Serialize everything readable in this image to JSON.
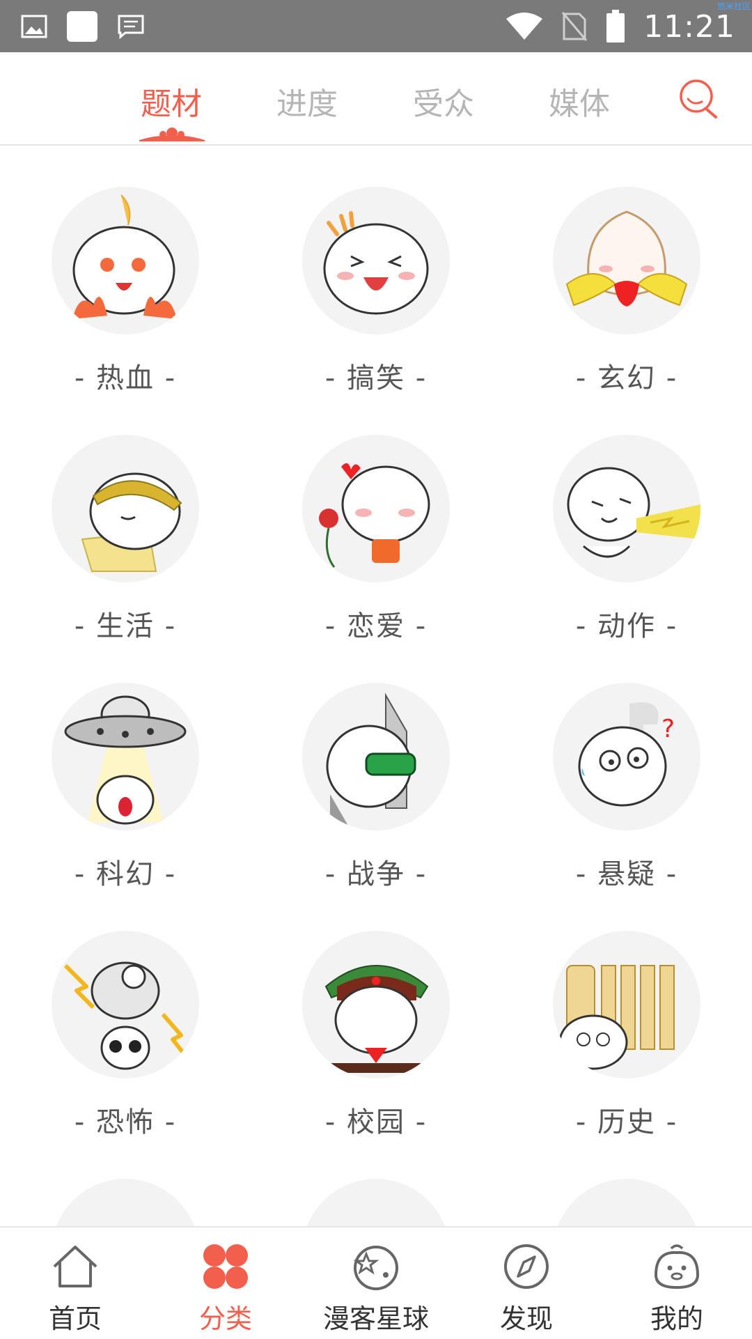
{
  "status_bar": {
    "time": "11:21",
    "corner_text": "悠米社区",
    "icons": [
      "image-icon",
      "square-icon",
      "message-icon",
      "wifi-icon",
      "no-sim-icon",
      "battery-icon"
    ]
  },
  "top_tabs": [
    {
      "label": "题材",
      "active": true
    },
    {
      "label": "进度",
      "active": false
    },
    {
      "label": "受众",
      "active": false
    },
    {
      "label": "媒体",
      "active": false
    }
  ],
  "colors": {
    "accent": "#f2604d",
    "inactive": "#b5b5b5",
    "label": "#555555",
    "status_bar": "#7a7a7a"
  },
  "categories": [
    {
      "label": "- 热血 -"
    },
    {
      "label": "- 搞笑 -"
    },
    {
      "label": "- 玄幻 -"
    },
    {
      "label": "- 生活 -"
    },
    {
      "label": "- 恋爱 -"
    },
    {
      "label": "- 动作 -"
    },
    {
      "label": "- 科幻 -"
    },
    {
      "label": "- 战争 -"
    },
    {
      "label": "- 悬疑 -"
    },
    {
      "label": "- 恐怖 -"
    },
    {
      "label": "- 校园 -"
    },
    {
      "label": "- 历史 -"
    }
  ],
  "bottom_nav": [
    {
      "label": "首页",
      "icon": "home-icon",
      "active": false
    },
    {
      "label": "分类",
      "icon": "category-icon",
      "active": true
    },
    {
      "label": "漫客星球",
      "icon": "planet-icon",
      "active": false
    },
    {
      "label": "发现",
      "icon": "compass-icon",
      "active": false
    },
    {
      "label": "我的",
      "icon": "profile-icon",
      "active": false
    }
  ]
}
